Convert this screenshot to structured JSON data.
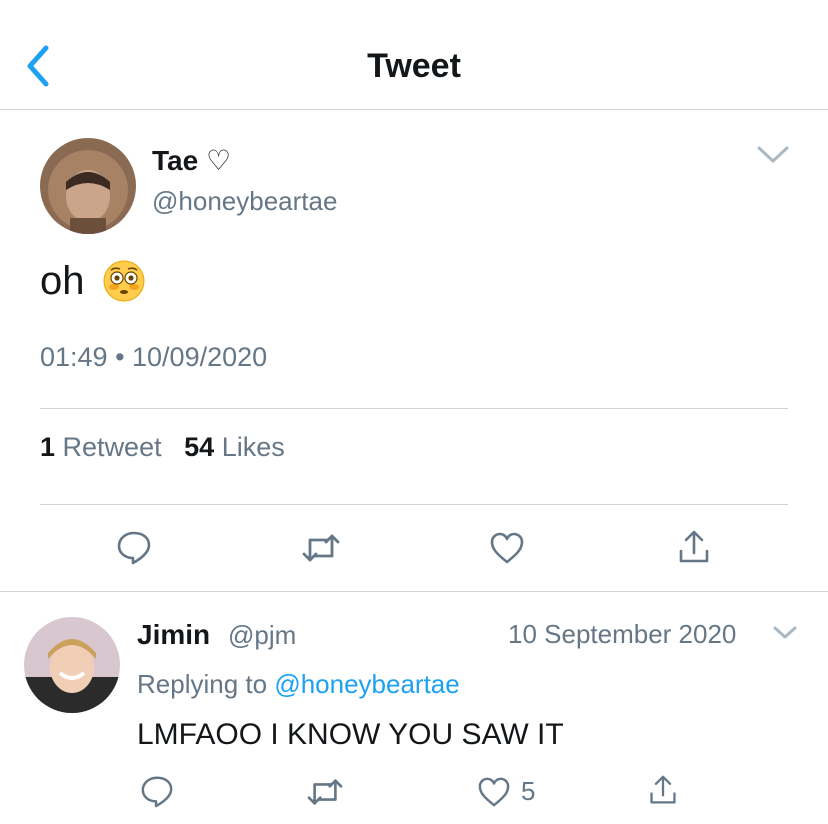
{
  "header": {
    "title": "Tweet"
  },
  "tweet": {
    "author_name": "Tae ♡",
    "author_handle": "@honeybeartae",
    "text": "oh",
    "emoji": "flushed-face",
    "timestamp": "01:49 • 10/09/2020",
    "retweet_count": "1",
    "retweet_label": "Retweet",
    "like_count": "54",
    "like_label": "Likes"
  },
  "reply": {
    "author_name": "Jimin",
    "author_handle": "@pjm",
    "date": "10 September 2020",
    "replying_label": "Replying to",
    "replying_to": "@honeybeartae",
    "text": "LMFAOO I KNOW YOU SAW IT",
    "like_count": "5"
  },
  "colors": {
    "accent": "#1da1f2",
    "secondary_text": "#657786",
    "primary_text": "#14171a",
    "divider": "#cfd3d6"
  }
}
